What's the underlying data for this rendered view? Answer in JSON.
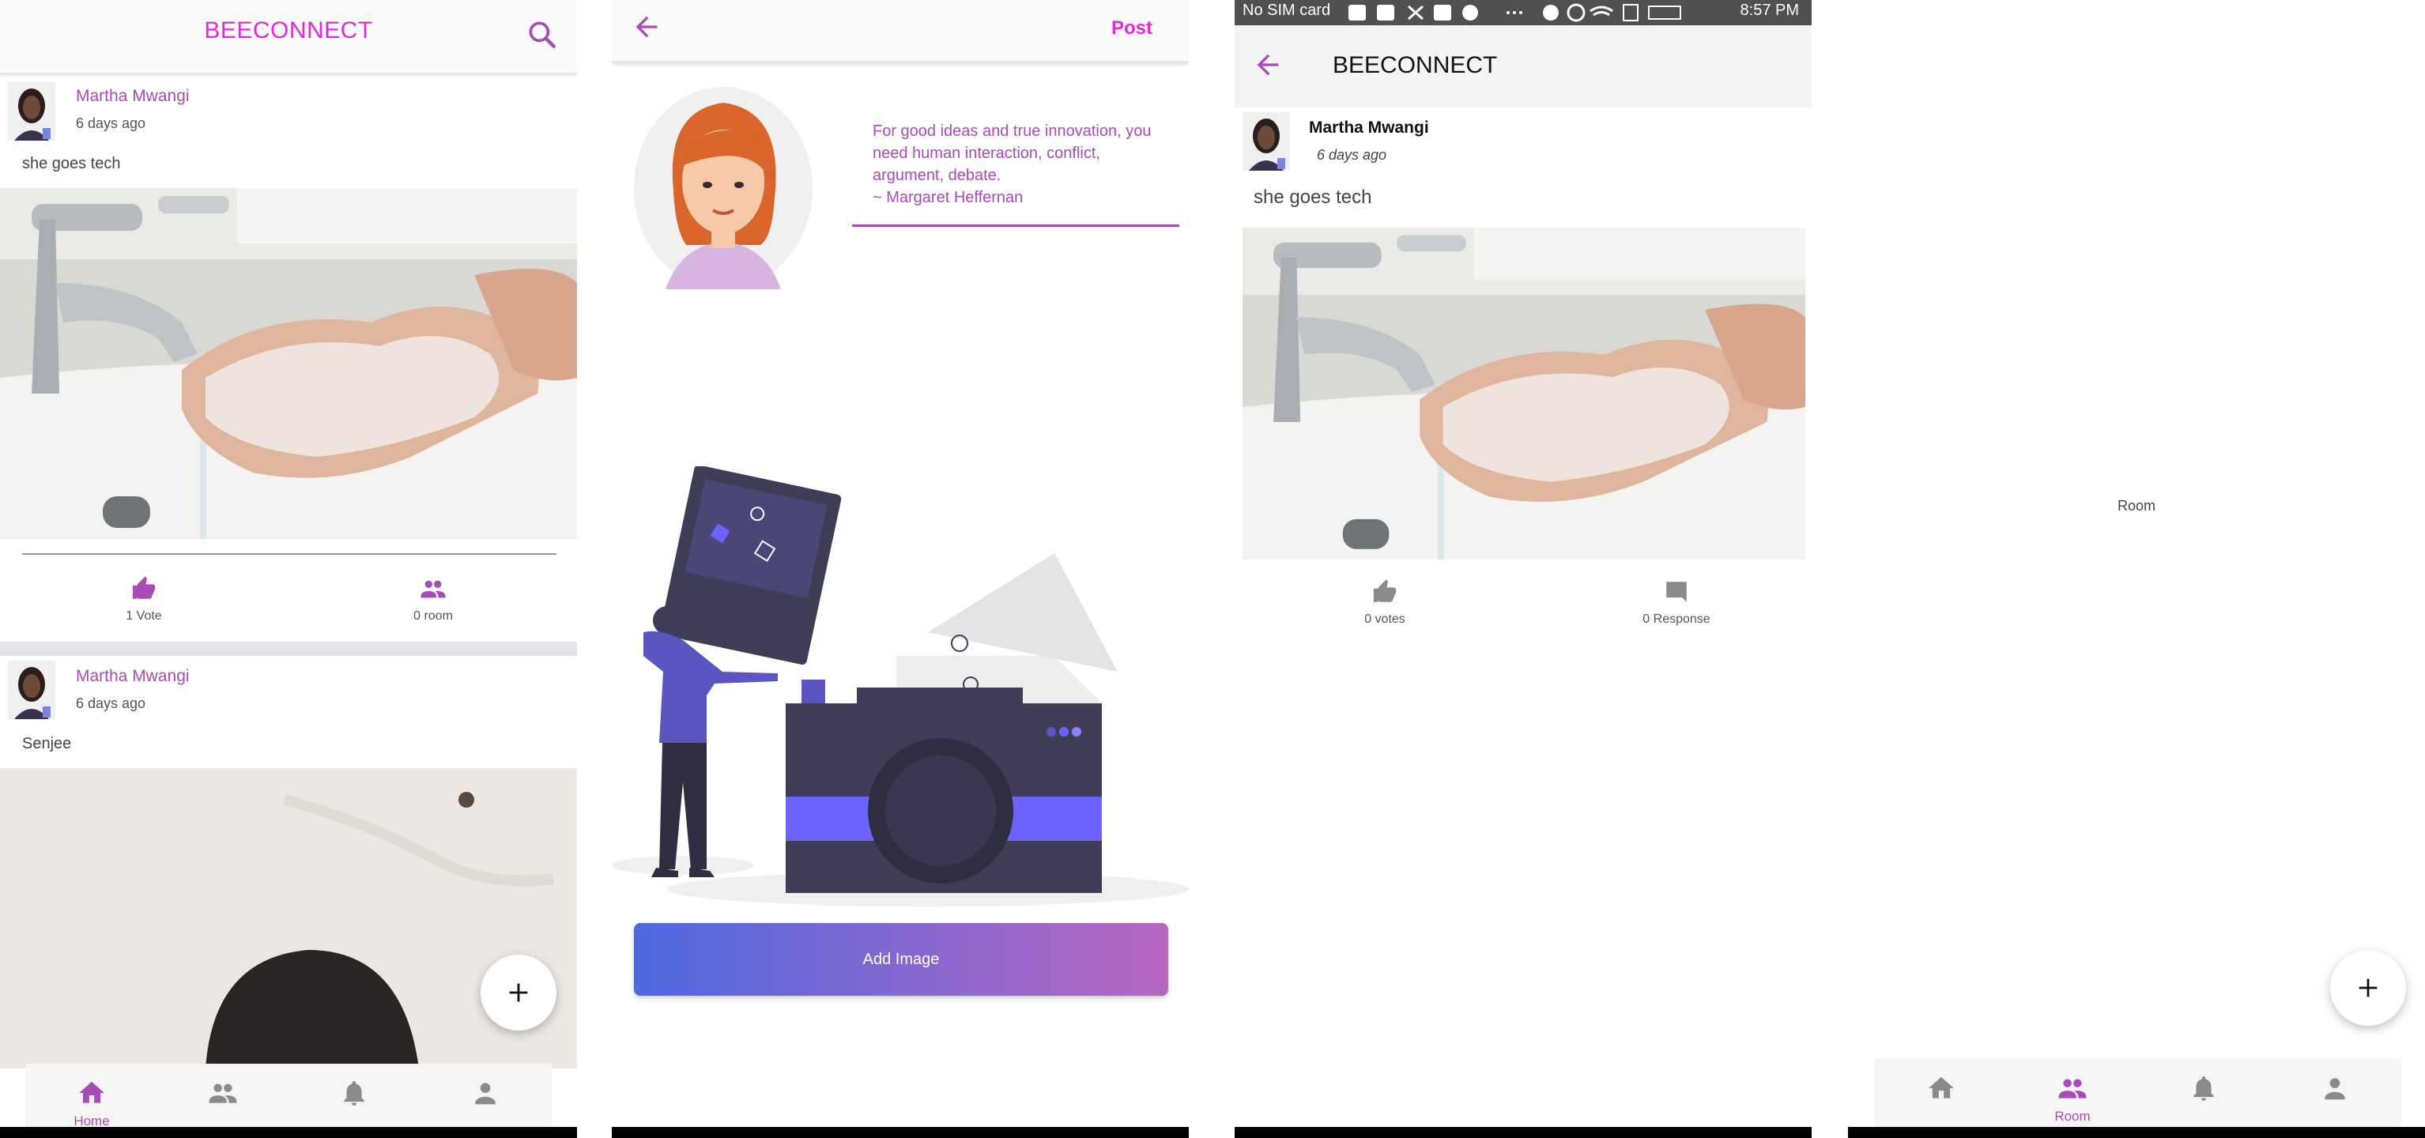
{
  "feed": {
    "brand": "BEECONNECT",
    "posts": [
      {
        "author": "Martha Mwangi",
        "time": "6 days ago",
        "text": "she goes tech",
        "vote_label": "1 Vote",
        "room_label": "0 room"
      },
      {
        "author": "Martha Mwangi",
        "time": "6 days ago",
        "text": "Senjee"
      }
    ],
    "nav": {
      "home_label": "Home"
    }
  },
  "compose": {
    "post_label": "Post",
    "quote": "For good ideas and true innovation, you need human interaction, conflict, argument, debate.",
    "quote_author": "~ Margaret Heffernan",
    "add_image_label": "Add Image"
  },
  "detail": {
    "status": {
      "carrier": "No SIM card",
      "time": "8:57 PM"
    },
    "title": "BEECONNECT",
    "author": "Martha Mwangi",
    "time": "6 days ago",
    "text": "she goes tech",
    "votes_label": "0 votes",
    "responses_label": "0 Response"
  },
  "room": {
    "center_label": "Room",
    "nav": {
      "room_label": "Room"
    }
  },
  "colors": {
    "accent": "#a94bb6",
    "brand": "#e628d9",
    "icon_grey": "#8a8a8a"
  }
}
